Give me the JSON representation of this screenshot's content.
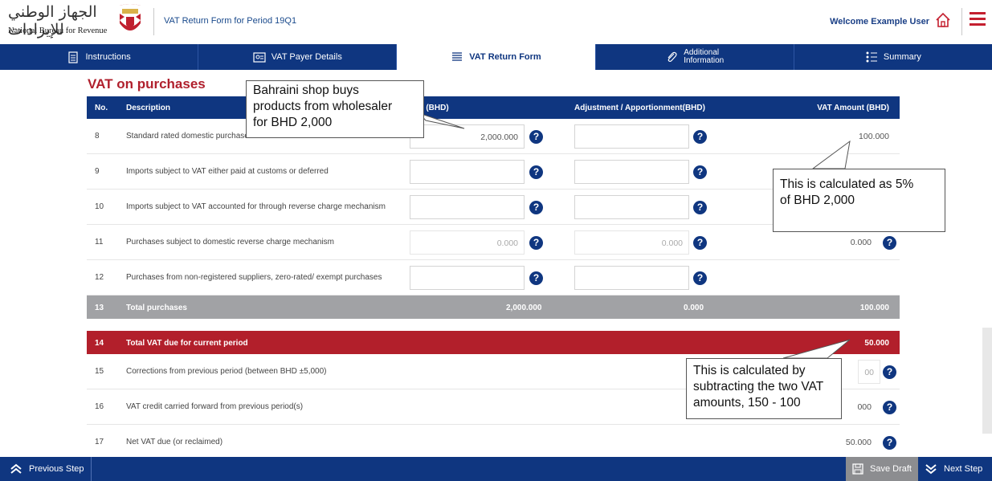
{
  "header": {
    "logo_arabic": "الجهاز الوطني للإيرادات",
    "logo_english": "National Bureau for Revenue",
    "page_title": "VAT Return Form for Period 19Q1",
    "welcome": "Welcome Example User"
  },
  "tabs": [
    {
      "label": "Instructions",
      "icon": "clipboard-icon",
      "active": false
    },
    {
      "label": "VAT Payer Details",
      "icon": "id-card-icon",
      "active": false
    },
    {
      "label": "VAT Return Form",
      "icon": "list-icon",
      "active": true
    },
    {
      "label_line1": "Additional",
      "label_line2": "Information",
      "icon": "paperclip-icon",
      "active": false
    },
    {
      "label": "Summary",
      "icon": "bullet-list-icon",
      "active": false
    }
  ],
  "section_title": "VAT on purchases",
  "table_header": {
    "no": "No.",
    "description": "Description",
    "amount": "unt (BHD)",
    "adjustment": "Adjustment / Apportionment(BHD)",
    "vat": "VAT Amount (BHD)"
  },
  "rows": [
    {
      "no": "8",
      "description": "Standard rated domestic purchases",
      "amount": "2,000.000",
      "adjustment": "",
      "vat": "100.000"
    },
    {
      "no": "9",
      "description": "Imports subject to VAT either paid at customs or deferred",
      "amount": "",
      "adjustment": "",
      "vat": ""
    },
    {
      "no": "10",
      "description": "Imports subject to VAT accounted for through reverse charge mechanism",
      "amount": "",
      "adjustment": "",
      "vat": ""
    },
    {
      "no": "11",
      "description": "Purchases subject to domestic reverse charge mechanism",
      "amount": "0.000",
      "adjustment": "0.000",
      "vat": "0.000"
    },
    {
      "no": "12",
      "description": "Purchases from non-registered suppliers, zero-rated/ exempt purchases",
      "amount": "",
      "adjustment": "",
      "vat": ""
    }
  ],
  "total13": {
    "no": "13",
    "label": "Total purchases",
    "amount": "2,000.000",
    "adjustment": "0.000",
    "vat": "100.000"
  },
  "total14": {
    "no": "14",
    "label": "Total VAT due for current period",
    "vat": "50.000"
  },
  "rows_after": [
    {
      "no": "15",
      "description": "Corrections from previous period (between BHD ±5,000)",
      "vat": "00"
    },
    {
      "no": "16",
      "description": "VAT credit carried forward from previous period(s)",
      "vat": "000"
    },
    {
      "no": "17",
      "description": "Net VAT due (or reclaimed)",
      "vat": "50.000"
    }
  ],
  "footer": {
    "previous": "Previous Step",
    "save_draft": "Save Draft",
    "next": "Next Step"
  },
  "callouts": {
    "purchase_line1": "Bahraini shop buys",
    "purchase_line2": "products from wholesaler",
    "purchase_line3": "for BHD 2,000",
    "vat5_line1": "This is calculated as 5%",
    "vat5_line2": "of BHD 2,000",
    "subtract_line1": "This is calculated by",
    "subtract_line2": "subtracting the two VAT",
    "subtract_line3": "amounts, 150 - 100"
  },
  "colors": {
    "navy": "#0f3680",
    "red": "#b21f2b",
    "grey_total": "#a1a2a5"
  }
}
